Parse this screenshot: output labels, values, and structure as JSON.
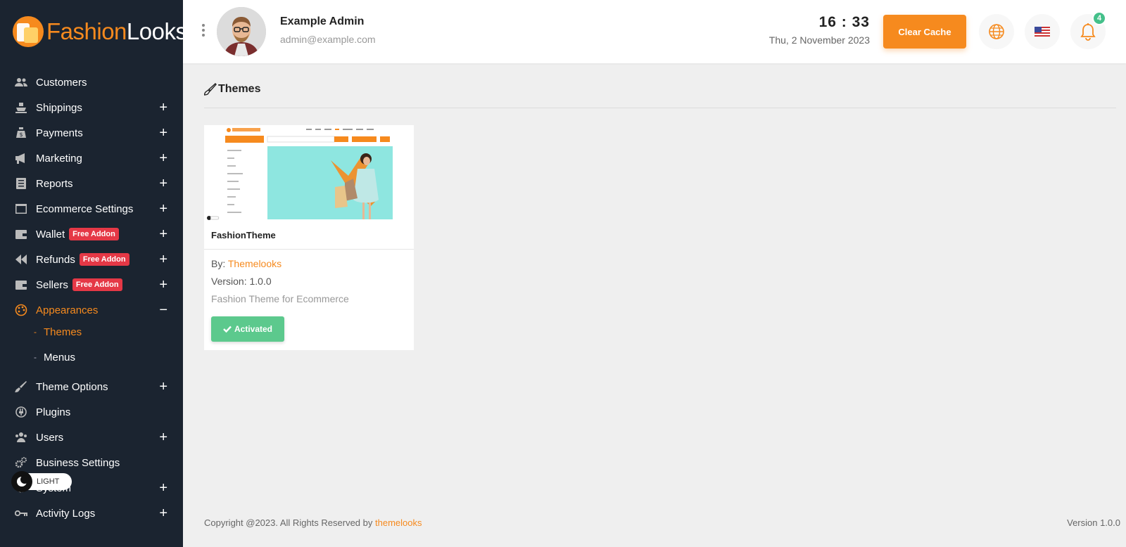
{
  "brand": {
    "part1": "Fashion",
    "part2": "Looks"
  },
  "colors": {
    "accent": "#f68a1e",
    "sidebar_bg": "#1b2430",
    "badge": "#e53846",
    "success": "#5cc98d"
  },
  "sidebar": {
    "items": [
      {
        "label": "Customers",
        "icon": "customers-icon"
      },
      {
        "label": "Shippings",
        "icon": "ship-icon"
      },
      {
        "label": "Payments",
        "icon": "money-bag-icon"
      },
      {
        "label": "Marketing",
        "icon": "megaphone-icon"
      },
      {
        "label": "Reports",
        "icon": "report-icon"
      },
      {
        "label": "Ecommerce Settings",
        "icon": "window-icon"
      },
      {
        "label": "Wallet",
        "icon": "wallet-icon",
        "badge": "Free Addon"
      },
      {
        "label": "Refunds",
        "icon": "rewind-icon",
        "badge": "Free Addon"
      },
      {
        "label": "Sellers",
        "icon": "wallet-icon",
        "badge": "Free Addon"
      },
      {
        "label": "Appearances",
        "icon": "palette-icon"
      },
      {
        "label": "Theme Options",
        "icon": "brush-icon"
      },
      {
        "label": "Plugins",
        "icon": "plugin-icon"
      },
      {
        "label": "Users",
        "icon": "users-icon"
      },
      {
        "label": "Business Settings",
        "icon": "gears-icon"
      },
      {
        "label": "System",
        "icon": "gear-icon"
      },
      {
        "label": "Activity Logs",
        "icon": "key-icon"
      }
    ],
    "subitems": [
      {
        "label": "Themes"
      },
      {
        "label": "Menus"
      }
    ],
    "theme_toggle": "LIGHT"
  },
  "header": {
    "user_name": "Example Admin",
    "user_email": "admin@example.com",
    "time": "16 : 33",
    "date": "Thu, 2 November 2023",
    "clear_cache": "Clear Cache",
    "notification_count": "4"
  },
  "main": {
    "title": "Themes",
    "theme_card": {
      "name": "FashionTheme",
      "by_label": "By:",
      "author": "Themelooks",
      "version": "Version: 1.0.0",
      "description": "Fashion Theme for Ecommerce",
      "status_button": "Activated"
    }
  },
  "footer": {
    "copyright": "Copyright @2023. All Rights Reserved by",
    "company": "themelooks",
    "version": "Version 1.0.0"
  }
}
